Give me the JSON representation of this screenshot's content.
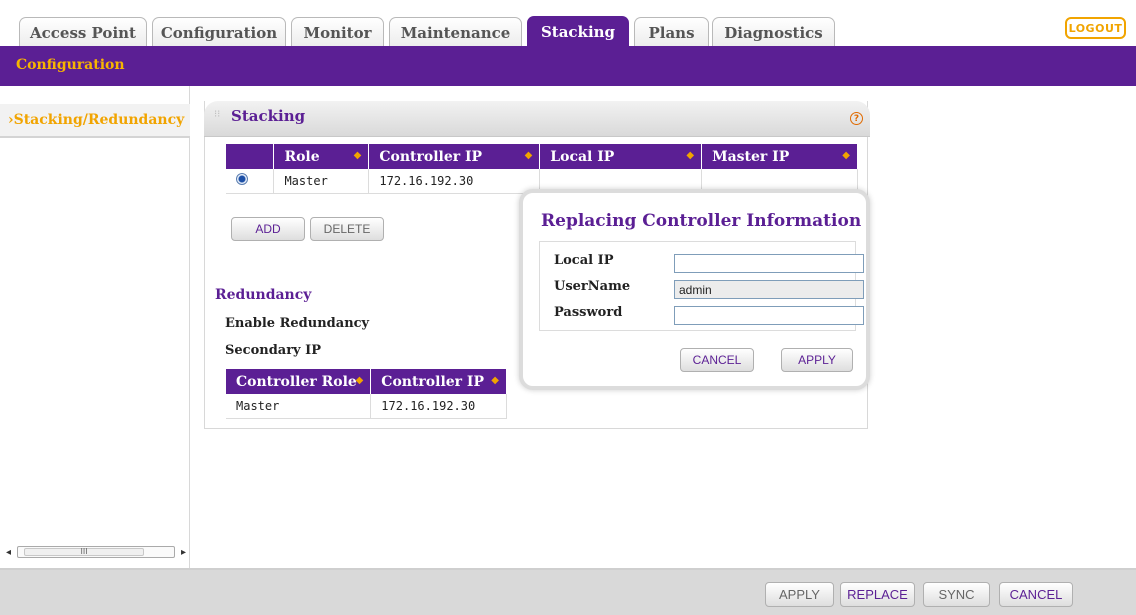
{
  "tabs": [
    {
      "label": "Access Point",
      "active": false
    },
    {
      "label": "Configuration",
      "active": false
    },
    {
      "label": "Monitor",
      "active": false
    },
    {
      "label": "Maintenance",
      "active": false
    },
    {
      "label": "Stacking",
      "active": true
    },
    {
      "label": "Plans",
      "active": false
    },
    {
      "label": "Diagnostics",
      "active": false
    }
  ],
  "header": {
    "logout_label": "LOGOUT",
    "section_label": "Configuration"
  },
  "sidebar": {
    "items": [
      {
        "label": "›Stacking/Redundancy"
      }
    ],
    "scroll_thumb": "III"
  },
  "stacking": {
    "title": "Stacking",
    "help_icon": "?",
    "columns": [
      "Role",
      "Controller IP",
      "Local IP",
      "Master IP"
    ],
    "rows": [
      {
        "selected": true,
        "role": "Master",
        "controller_ip": "172.16.192.30",
        "local_ip": "",
        "master_ip": ""
      }
    ],
    "add_label": "ADD",
    "delete_label": "DELETE"
  },
  "redundancy": {
    "title": "Redundancy",
    "enable_label": "Enable Redundancy",
    "secondary_ip_label": "Secondary IP",
    "columns": [
      "Controller Role",
      "Controller IP"
    ],
    "rows": [
      {
        "role": "Master",
        "controller_ip": "172.16.192.30"
      }
    ]
  },
  "dialog": {
    "title": "Replacing Controller Information",
    "local_ip_label": "Local IP",
    "local_ip_value": "",
    "username_label": "UserName",
    "username_value": "admin",
    "password_label": "Password",
    "password_value": "",
    "cancel_label": "CANCEL",
    "apply_label": "APPLY"
  },
  "footer": {
    "apply_label": "APPLY",
    "replace_label": "REPLACE",
    "sync_label": "SYNC",
    "cancel_label": "CANCEL"
  },
  "colors": {
    "brand_purple": "#5b1f94",
    "accent_orange": "#f1a400"
  }
}
